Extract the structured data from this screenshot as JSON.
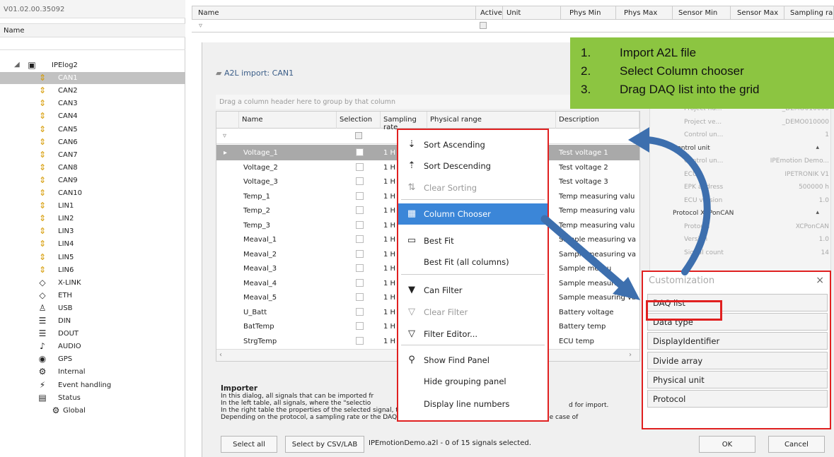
{
  "app": {
    "version": "V01.02.00.35092",
    "name_header": "Name"
  },
  "tree": [
    {
      "label": "IPElog2",
      "icon": "logger-icon"
    },
    {
      "label": "CAN1",
      "icon": "can-icon",
      "selected": true
    },
    {
      "label": "CAN2",
      "icon": "can-icon"
    },
    {
      "label": "CAN3",
      "icon": "can-icon"
    },
    {
      "label": "CAN4",
      "icon": "can-icon"
    },
    {
      "label": "CAN5",
      "icon": "can-icon"
    },
    {
      "label": "CAN6",
      "icon": "can-icon"
    },
    {
      "label": "CAN7",
      "icon": "can-icon"
    },
    {
      "label": "CAN8",
      "icon": "can-icon"
    },
    {
      "label": "CAN9",
      "icon": "can-icon"
    },
    {
      "label": "CAN10",
      "icon": "can-icon"
    },
    {
      "label": "LIN1",
      "icon": "can-icon"
    },
    {
      "label": "LIN2",
      "icon": "can-icon"
    },
    {
      "label": "LIN3",
      "icon": "can-icon"
    },
    {
      "label": "LIN4",
      "icon": "can-icon"
    },
    {
      "label": "LIN5",
      "icon": "can-icon"
    },
    {
      "label": "LIN6",
      "icon": "can-icon"
    },
    {
      "label": "X-LINK",
      "icon": "xlink-icon"
    },
    {
      "label": "ETH",
      "icon": "eth-icon"
    },
    {
      "label": "USB",
      "icon": "usb-icon"
    },
    {
      "label": "DIN",
      "icon": "din-icon"
    },
    {
      "label": "DOUT",
      "icon": "dout-icon"
    },
    {
      "label": "AUDIO",
      "icon": "audio-icon"
    },
    {
      "label": "GPS",
      "icon": "gps-icon"
    },
    {
      "label": "Internal",
      "icon": "internal-icon"
    },
    {
      "label": "Event handling",
      "icon": "event-icon"
    },
    {
      "label": "Status",
      "icon": "status-icon"
    },
    {
      "label": "Global",
      "icon": "global-icon"
    }
  ],
  "main_grid": {
    "headers": [
      "Name",
      "Active",
      "Unit",
      "Phys Min",
      "Phys Max",
      "Sensor Min",
      "Sensor Max",
      "Sampling ra"
    ]
  },
  "dialog": {
    "title": "A2L import: CAN1",
    "group_hint": "Drag a column header here to group by that column",
    "headers": [
      "Name",
      "Selection",
      "Sampling rate",
      "Physical range",
      "Description"
    ],
    "rows": [
      {
        "name": "Voltage_1",
        "rate": "1 H",
        "desc": "Test voltage 1"
      },
      {
        "name": "Voltage_2",
        "rate": "1 H",
        "desc": "Test voltage 2"
      },
      {
        "name": "Voltage_3",
        "rate": "1 H",
        "desc": "Test voltage 3"
      },
      {
        "name": "Temp_1",
        "rate": "1 H",
        "desc": "Temp measuring valu"
      },
      {
        "name": "Temp_2",
        "rate": "1 H",
        "desc": "Temp measuring valu"
      },
      {
        "name": "Temp_3",
        "rate": "1 H",
        "desc": "Temp measuring valu"
      },
      {
        "name": "Meaval_1",
        "rate": "1 H",
        "desc": "Sample measuring va"
      },
      {
        "name": "Meaval_2",
        "rate": "1 H",
        "desc": "Sample measuring va"
      },
      {
        "name": "Meaval_3",
        "rate": "1 H",
        "desc": "Sample measu"
      },
      {
        "name": "Meaval_4",
        "rate": "1 H",
        "desc": "Sample measuring"
      },
      {
        "name": "Meaval_5",
        "rate": "1 H",
        "desc": "Sample measuring va"
      },
      {
        "name": "U_Batt",
        "rate": "1 H",
        "desc": "Battery voltage"
      },
      {
        "name": "BatTemp",
        "rate": "1 H",
        "desc": "Battery temp"
      },
      {
        "name": "StrgTemp",
        "rate": "1 H",
        "desc": "ECU temp"
      }
    ],
    "importer_title": "Importer",
    "importer_lines": [
      "In this dialog, all signals that can be imported fr",
      "In the left table, all signals, where the \"selectio",
      "In the right table the properties of the selected signal, the control unit and the protocol are displayed.",
      "Depending on the protocol, a sampling rate or the DAQ list to use, can be assigned to the signals. In the case of"
    ],
    "importer_tail": "d for import.",
    "select_all": "Select all",
    "select_csv": "Select by CSV/LAB",
    "status": "IPEmotionDemo.a2l  -  0 of 15 signals selected.",
    "ok": "OK",
    "cancel": "Cancel"
  },
  "props": [
    {
      "type": "row",
      "k": "Project nu...",
      "v": "_DEMO010000"
    },
    {
      "type": "row",
      "k": "Project ve...",
      "v": "_DEMO010000"
    },
    {
      "type": "row",
      "k": "Control un...",
      "v": "1"
    },
    {
      "type": "group",
      "k": "Control unit"
    },
    {
      "type": "row",
      "k": "Control un...",
      "v": "IPEmotion Demo..."
    },
    {
      "type": "row",
      "k": "ECU",
      "v": "IPETRONIK V1"
    },
    {
      "type": "row",
      "k": "EPK address",
      "v": "500000 h"
    },
    {
      "type": "row",
      "k": "ECU version",
      "v": "1.0"
    },
    {
      "type": "group",
      "k": "Protocol XCPonCAN"
    },
    {
      "type": "row",
      "k": "Protocol",
      "v": "XCPonCAN"
    },
    {
      "type": "row",
      "k": "Version",
      "v": "1.0"
    },
    {
      "type": "row",
      "k": "Signal count",
      "v": "14"
    }
  ],
  "callout": {
    "steps": [
      "Import A2L file",
      "Select Column chooser",
      "Drag DAQ list into the grid"
    ],
    "color": "#8cc541"
  },
  "context_menu": [
    {
      "label": "Sort Ascending",
      "icon": "sort-ascending-icon",
      "glyph": "⇣",
      "enabled": true
    },
    {
      "label": "Sort Descending",
      "icon": "sort-descending-icon",
      "glyph": "⇡",
      "enabled": true
    },
    {
      "label": "Clear Sorting",
      "icon": "clear-sorting-icon",
      "glyph": "⇅",
      "enabled": false
    },
    {
      "label": "Column Chooser",
      "icon": "column-chooser-icon",
      "glyph": "▦",
      "enabled": true,
      "highlight": true
    },
    {
      "label": "Best Fit",
      "icon": "best-fit-icon",
      "glyph": "▭",
      "enabled": true
    },
    {
      "label": "Best Fit (all columns)",
      "icon": "",
      "glyph": "",
      "enabled": true
    },
    {
      "label": "Can Filter",
      "icon": "filter-icon",
      "glyph": "▼",
      "enabled": true
    },
    {
      "label": "Clear Filter",
      "icon": "clear-filter-icon",
      "glyph": "▽",
      "enabled": false
    },
    {
      "label": "Filter Editor...",
      "icon": "filter-editor-icon",
      "glyph": "▽",
      "enabled": true
    },
    {
      "label": "Show Find Panel",
      "icon": "search-icon",
      "glyph": "⚲",
      "enabled": true
    },
    {
      "label": "Hide grouping panel",
      "icon": "",
      "glyph": "",
      "enabled": true
    },
    {
      "label": "Display line numbers",
      "icon": "",
      "glyph": "",
      "enabled": true
    }
  ],
  "customization": {
    "title": "Customization",
    "close": "×",
    "items": [
      "DAQ list",
      "Data type",
      "DisplayIdentifier",
      "Divide array",
      "Physical unit",
      "Protocol"
    ]
  },
  "colors": {
    "highlight_red": "#e02020",
    "menu_highlight": "#3b86d8",
    "arrow": "#3d6fae"
  }
}
